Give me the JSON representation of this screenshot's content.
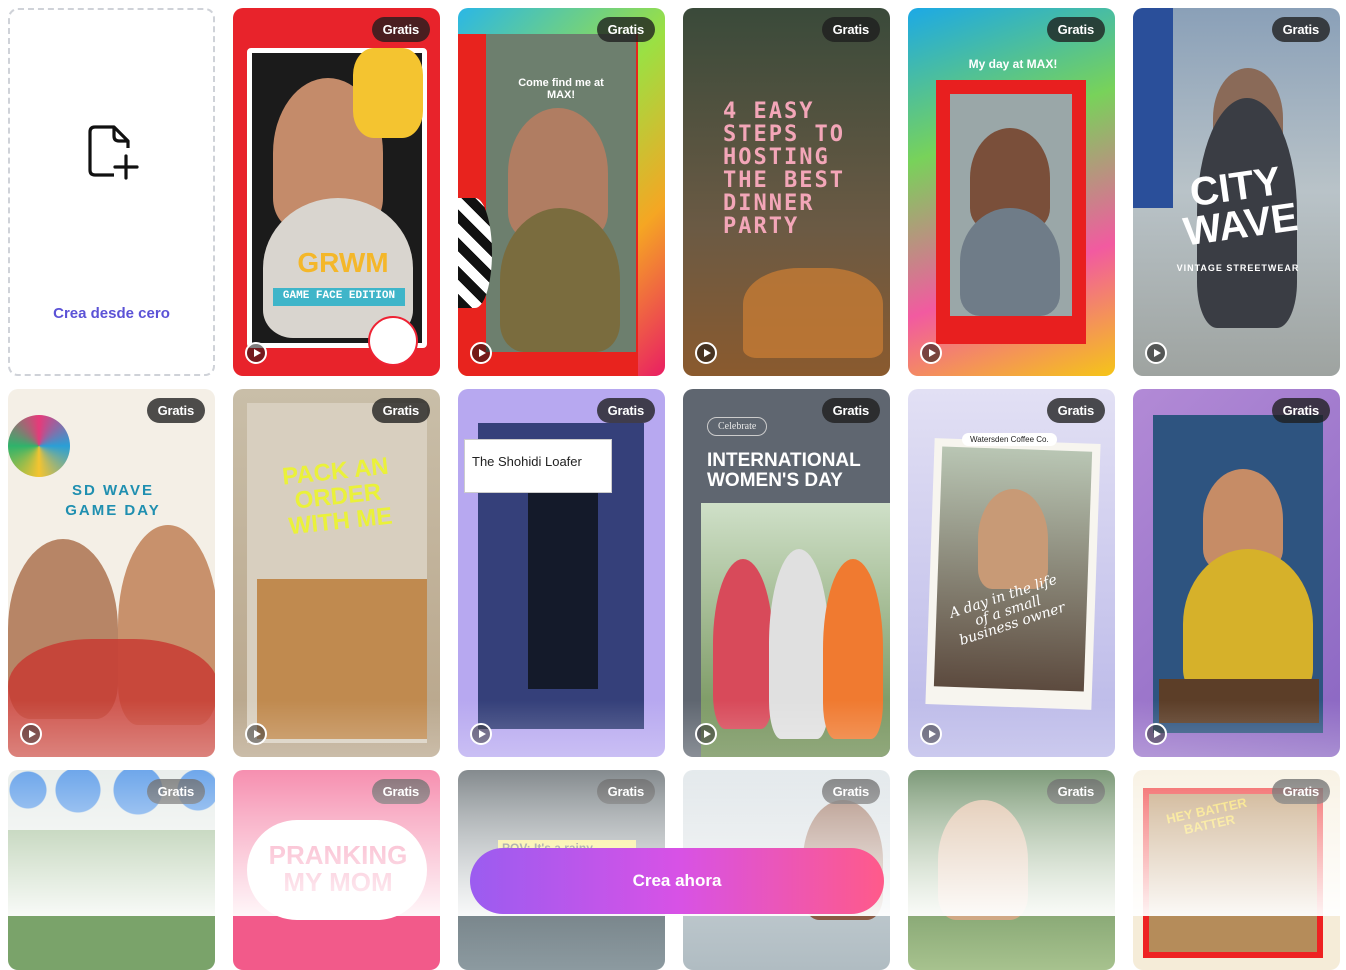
{
  "blank_card": {
    "label": "Crea desde cero",
    "icon": "new-file-icon"
  },
  "badge_label": "Gratis",
  "templates": [
    {
      "id": "grwm",
      "title": "GRWM",
      "subtitle": "GAME FACE EDITION"
    },
    {
      "id": "come-find-me",
      "title": "Come find me at MAX!"
    },
    {
      "id": "dinner-party",
      "title": "4 EASY STEPS TO HOSTING THE BEST DINNER PARTY"
    },
    {
      "id": "my-day",
      "title": "My day at MAX!"
    },
    {
      "id": "city-wave",
      "title": "CITY WAVE",
      "subtitle": "VINTAGE STREETWEAR"
    },
    {
      "id": "sd-wave",
      "title": "SD WAVE GAME DAY"
    },
    {
      "id": "pack-order",
      "title": "PACK AN ORDER WITH ME"
    },
    {
      "id": "loafer",
      "title": "The Shohidi Loafer"
    },
    {
      "id": "womens-day",
      "tag": "Celebrate",
      "title": "INTERNATIONAL WOMEN'S DAY"
    },
    {
      "id": "coffee",
      "tag": "Watersden Coffee Co.",
      "title": "A day in the life of a small business owner"
    },
    {
      "id": "podcast",
      "title": ""
    },
    {
      "id": "circles",
      "title": ""
    },
    {
      "id": "pranking",
      "title": "PRANKING MY MOM"
    },
    {
      "id": "pov",
      "title": "POV: It's a rainy"
    },
    {
      "id": "portrait",
      "title": ""
    },
    {
      "id": "plants",
      "title": ""
    },
    {
      "id": "batter",
      "title": "HEY BATTER BATTER"
    }
  ],
  "cta": {
    "label": "Crea ahora"
  },
  "colors": {
    "accent": "#5b52d6",
    "cta_start": "#9b5cf0",
    "cta_end": "#ff5a8a"
  }
}
